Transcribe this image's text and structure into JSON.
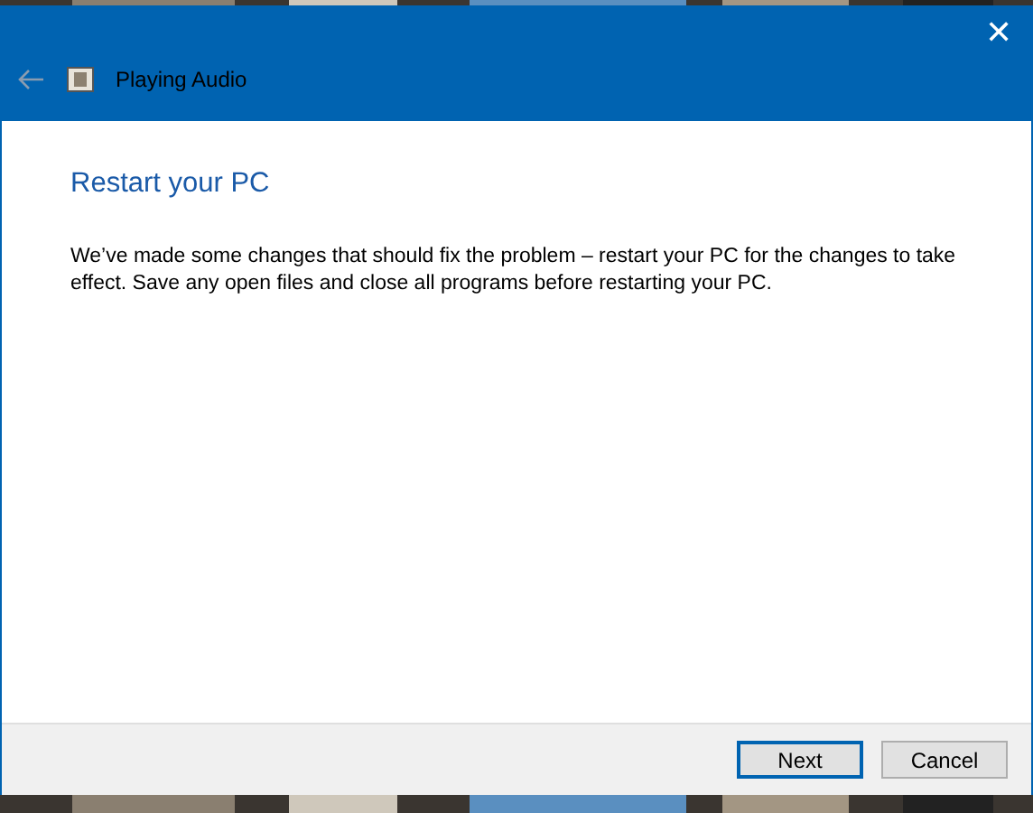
{
  "window": {
    "title": "Playing Audio",
    "back_enabled": false,
    "close": "✕"
  },
  "heading": "Restart your PC",
  "message": "We’ve made some changes that should fix the problem – restart your PC for the changes to take effect. Save any open files and close all programs before restarting your PC.",
  "buttons": [
    {
      "label": "Next",
      "default": true
    },
    {
      "label": "Cancel",
      "default": false
    }
  ]
}
